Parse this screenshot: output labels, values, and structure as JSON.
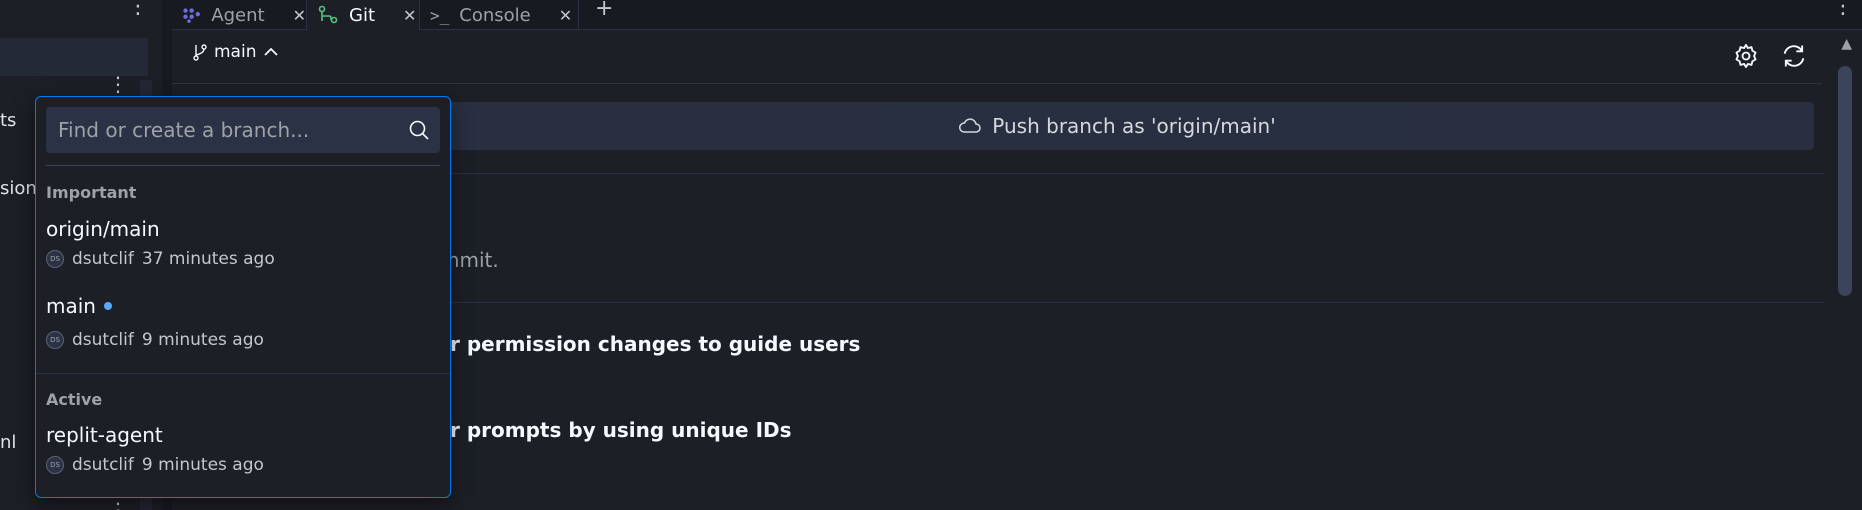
{
  "left_fragments": [
    "ts",
    "sion-",
    "nl"
  ],
  "tabs": [
    {
      "label": "Agent",
      "icon": "agent-icon"
    },
    {
      "label": "Git",
      "icon": "git-icon"
    },
    {
      "label": "Console",
      "icon": "console-icon"
    }
  ],
  "header": {
    "branch": "main"
  },
  "main": {
    "push_label": "Push branch as 'origin/main'",
    "text_1": "mmit.",
    "text_2": "r permission changes to guide users",
    "text_3": "r prompts by using unique IDs"
  },
  "dropdown": {
    "placeholder": "Find or create a branch...",
    "sections": [
      {
        "title": "Important",
        "branches": [
          {
            "name": "origin/main",
            "avatar": "DS",
            "author": "dsutclif",
            "time": "37 minutes ago",
            "current": false
          },
          {
            "name": "main",
            "avatar": "DS",
            "author": "dsutclif",
            "time": "9 minutes ago",
            "current": true
          }
        ]
      },
      {
        "title": "Active",
        "branches": [
          {
            "name": "replit-agent",
            "avatar": "DS",
            "author": "dsutclif",
            "time": "9 minutes ago",
            "current": false
          }
        ]
      }
    ]
  },
  "colors": {
    "background": "#1c1f26",
    "accent": "#0079f2",
    "git_green": "#57c27d",
    "current_dot": "#57abff"
  }
}
